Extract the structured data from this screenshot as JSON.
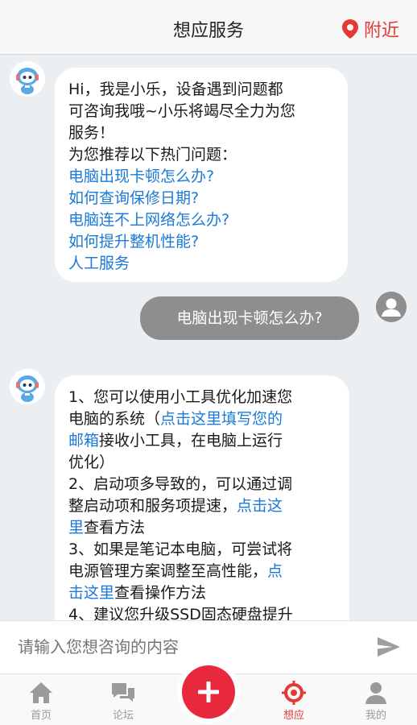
{
  "header": {
    "title": "想应服务",
    "nearby_label": "附近"
  },
  "chat": {
    "bot_message_1": {
      "lines": [
        "Hi，我是小乐，设备遇到问题都",
        "可咨询我哦~小乐将竭尽全力为您",
        "服务！",
        "为您推荐以下热门问题："
      ],
      "links": [
        "电脑出现卡顿怎么办?",
        "如何查询保修日期?",
        "电脑连不上网络怎么办?",
        "如何提升整机性能?",
        "人工服务"
      ]
    },
    "user_message": "电脑出现卡顿怎么办?",
    "bot_message_2": {
      "l1": "1、您可以使用小工具优化加速您",
      "l2a": "电脑的系统（",
      "l2b": "点击这里填写您的",
      "l3a": "邮箱",
      "l3b": "接收小工具，在电脑上运行",
      "l4": "优化）",
      "l5": "2、启动项多导致的，可以通过调",
      "l6a": "整启动项和服务项提速，",
      "l6b": "点击这",
      "l7a": "里",
      "l7b": "查看方法",
      "l8": "3、如果是笔记本电脑，可尝试将",
      "l9a": "电源管理方案调整至高性能，",
      "l9b": "点",
      "l10a": "击这里",
      "l10b": "查看操作方法",
      "l11": "4、建议您升级SSD固态硬盘提升"
    }
  },
  "input": {
    "placeholder": "请输入您想咨询的内容"
  },
  "tabbar": {
    "items": [
      {
        "label": "首页",
        "icon": "home-icon"
      },
      {
        "label": "论坛",
        "icon": "forum-icon"
      },
      {
        "label": "想应",
        "icon": "target-icon",
        "active": true
      },
      {
        "label": "我的",
        "icon": "person-icon"
      }
    ],
    "fab_icon": "plus-icon"
  },
  "colors": {
    "accent": "#e53935",
    "link": "#1a7ad6",
    "user_bubble": "#8e8e8e",
    "chat_background": "#eceff1"
  }
}
